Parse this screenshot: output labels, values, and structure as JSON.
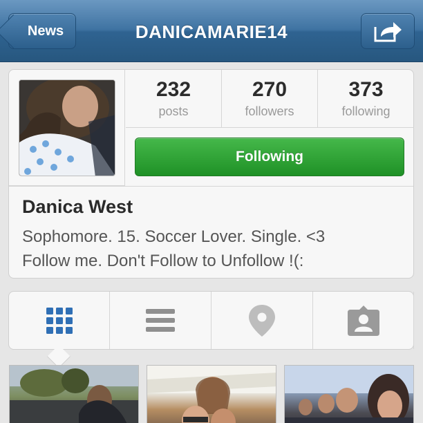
{
  "navbar": {
    "back_label": "News",
    "title": "DANICAMARIE14"
  },
  "profile": {
    "stats": [
      {
        "value": "232",
        "label": "posts"
      },
      {
        "value": "270",
        "label": "followers"
      },
      {
        "value": "373",
        "label": "following"
      }
    ],
    "follow_button_label": "Following",
    "name": "Danica West",
    "bio_line_1": "Sophomore. 15. Soccer Lover. Single. <3",
    "bio_line_2": "Follow me. Don't Follow to Unfollow !(:"
  },
  "tabs": [
    {
      "icon": "grid-icon",
      "selected": true
    },
    {
      "icon": "list-icon",
      "selected": false
    },
    {
      "icon": "location-pin-icon",
      "selected": false
    },
    {
      "icon": "tagged-user-icon",
      "selected": false
    }
  ],
  "colors": {
    "navbar_blue": "#3f73a2",
    "follow_green": "#2aa12f",
    "selected_tab_blue": "#2f6fb5"
  }
}
